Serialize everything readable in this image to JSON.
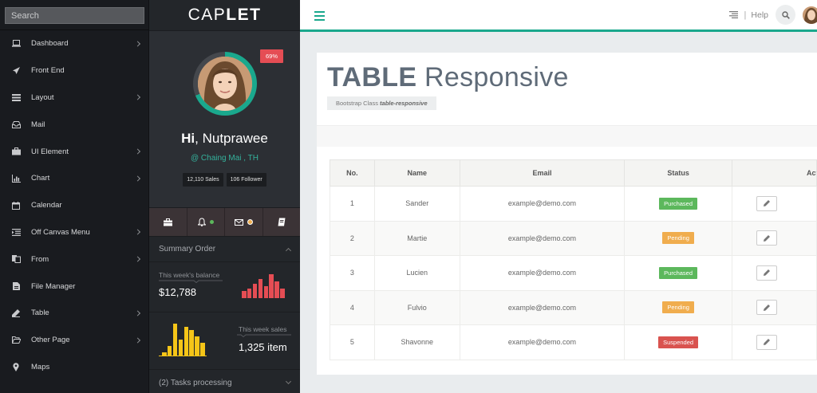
{
  "colors": {
    "accent": "#1aa88d",
    "purchased": "#5cb85c",
    "pending": "#f0ad4e",
    "suspended": "#d9534f",
    "bar_red": "#e54d54",
    "bar_yellow": "#f5c518"
  },
  "sidebar": {
    "search_placeholder": "Search",
    "items": [
      {
        "label": "Dashboard",
        "icon": "laptop-icon",
        "has_children": true
      },
      {
        "label": "Front End",
        "icon": "rocket-icon",
        "has_children": false
      },
      {
        "label": "Layout",
        "icon": "list-icon",
        "has_children": true
      },
      {
        "label": "Mail",
        "icon": "inbox-icon",
        "has_children": false
      },
      {
        "label": "UI Element",
        "icon": "briefcase-icon",
        "has_children": true
      },
      {
        "label": "Chart",
        "icon": "bar-chart-icon",
        "has_children": true
      },
      {
        "label": "Calendar",
        "icon": "calendar-icon",
        "has_children": false
      },
      {
        "label": "Off Canvas Menu",
        "icon": "indent-icon",
        "has_children": true
      },
      {
        "label": "From",
        "icon": "copy-icon",
        "has_children": true
      },
      {
        "label": "File Manager",
        "icon": "file-icon",
        "has_children": false
      },
      {
        "label": "Table",
        "icon": "pen-icon",
        "has_children": true
      },
      {
        "label": "Other Page",
        "icon": "folder-open-icon",
        "has_children": true
      },
      {
        "label": "Maps",
        "icon": "map-marker-icon",
        "has_children": false
      }
    ]
  },
  "brand": {
    "prefix": "CAP",
    "suffix": "LET"
  },
  "profile": {
    "progress_badge": "69%",
    "progress": 0.69,
    "greeting_hi": "Hi",
    "greeting_name": ", Nutprawee",
    "location": "@ Chaing Mai , TH",
    "sales": "12,110 Sales",
    "followers": "106 Follower"
  },
  "tools": [
    {
      "icon": "briefcase-icon"
    },
    {
      "icon": "bell-icon",
      "dot": "#5cb85c"
    },
    {
      "icon": "envelope-icon",
      "dot": "#f0ad4e"
    },
    {
      "icon": "book-icon"
    }
  ],
  "summary": {
    "title": "Summary Order",
    "balance_label": "This week's balance",
    "balance_value": "$12,788",
    "balance_bars": [
      3,
      4,
      6,
      8,
      5,
      10,
      7,
      4
    ],
    "sales_label": "This week sales",
    "sales_value": "1,325 item",
    "sales_bars": [
      1,
      3,
      10,
      5,
      9,
      8,
      6,
      4
    ]
  },
  "tasks": {
    "title": "(2) Tasks processing"
  },
  "topbar": {
    "help": "Help",
    "separator": "|"
  },
  "page": {
    "title_bold": "TABLE",
    "title_rest": " Responsive",
    "subtitle_prefix": "Bootstrap Class ",
    "subtitle_class": "table-responsive"
  },
  "table": {
    "headers": [
      "No.",
      "Name",
      "Email",
      "Status",
      "Action"
    ],
    "rows": [
      {
        "no": "1",
        "name": "Sander",
        "email": "example@demo.com",
        "status": "Purchased",
        "status_color": "#5cb85c"
      },
      {
        "no": "2",
        "name": "Martie",
        "email": "example@demo.com",
        "status": "Pending",
        "status_color": "#f0ad4e"
      },
      {
        "no": "3",
        "name": "Lucien",
        "email": "example@demo.com",
        "status": "Purchased",
        "status_color": "#5cb85c"
      },
      {
        "no": "4",
        "name": "Fulvio",
        "email": "example@demo.com",
        "status": "Pending",
        "status_color": "#f0ad4e"
      },
      {
        "no": "5",
        "name": "Shavonne",
        "email": "example@demo.com",
        "status": "Suspended",
        "status_color": "#d9534f"
      }
    ]
  }
}
